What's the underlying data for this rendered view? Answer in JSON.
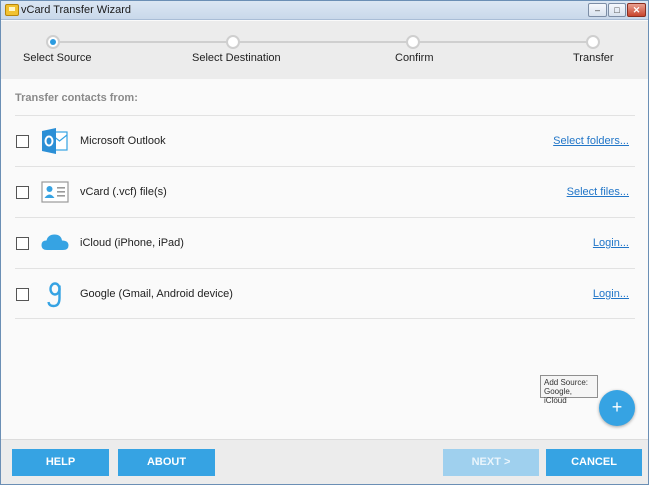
{
  "window": {
    "title": "vCard Transfer Wizard",
    "controls": {
      "minimize": "‒",
      "maximize": "□",
      "close": "✕"
    }
  },
  "steps": [
    {
      "label": "Select Source",
      "active": true
    },
    {
      "label": "Select Destination",
      "active": false
    },
    {
      "label": "Confirm",
      "active": false
    },
    {
      "label": "Transfer",
      "active": false
    }
  ],
  "content": {
    "heading": "Transfer contacts from:",
    "sources": [
      {
        "label": "Microsoft Outlook",
        "link": "Select folders...",
        "icon": "outlook-icon",
        "checked": false
      },
      {
        "label": "vCard (.vcf) file(s)",
        "link": "Select files...",
        "icon": "vcard-icon",
        "checked": false
      },
      {
        "label": "iCloud (iPhone, iPad)",
        "link": "Login...",
        "icon": "icloud-icon",
        "checked": false
      },
      {
        "label": "Google (Gmail, Android device)",
        "link": "Login...",
        "icon": "google-icon",
        "checked": false
      }
    ]
  },
  "tooltip": {
    "line1": "Add Source:",
    "line2": "Google, iCloud"
  },
  "fab": {
    "symbol": "+"
  },
  "footer": {
    "help": "HELP",
    "about": "ABOUT",
    "next": "NEXT >",
    "cancel": "CANCEL"
  },
  "colors": {
    "accent": "#36a3e3",
    "link": "#2276c8",
    "disabled": "#9fd0ee"
  }
}
